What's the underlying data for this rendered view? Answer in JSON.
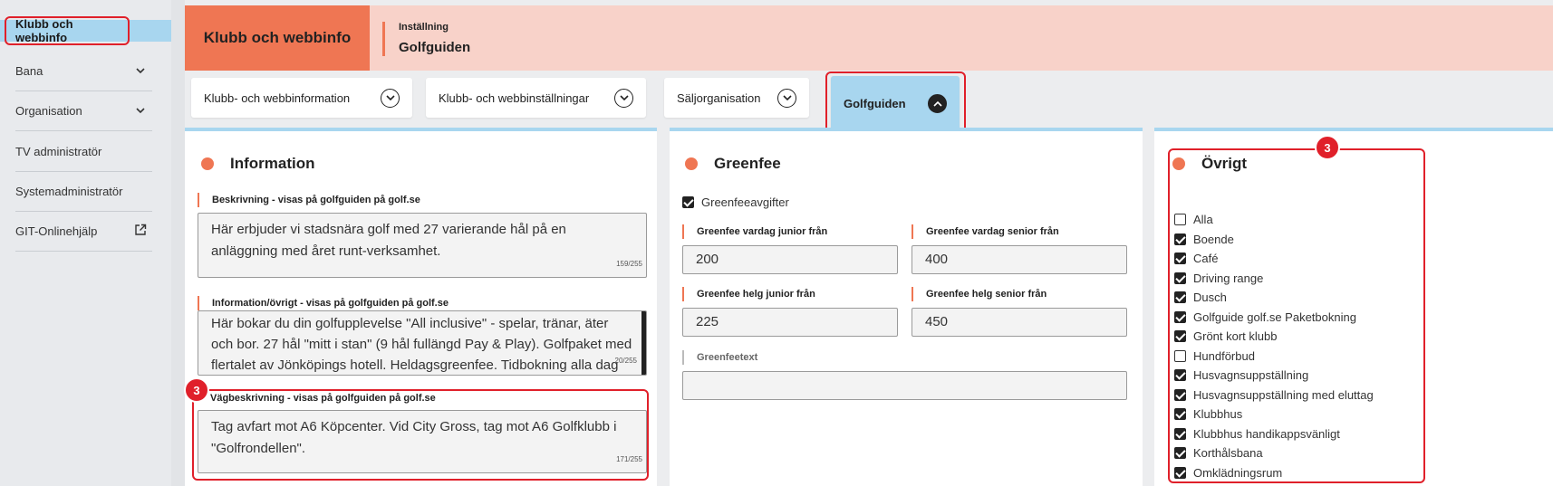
{
  "sidebar": {
    "active": "Klubb och webbinfo",
    "items": [
      {
        "label": "Bana",
        "has_chevron": true
      },
      {
        "label": "Organisation",
        "has_chevron": true
      },
      {
        "label": "TV administratör",
        "has_chevron": false
      },
      {
        "label": "Systemadministratör",
        "has_chevron": false
      },
      {
        "label": "GIT-Onlinehjälp",
        "has_external": true
      }
    ]
  },
  "header": {
    "title": "Klubb och webbinfo",
    "setting_label": "Inställning",
    "setting_value": "Golfguiden"
  },
  "tabs": [
    {
      "label": "Klubb- och webbinformation",
      "icon": "chevron-down-icon"
    },
    {
      "label": "Klubb- och webbinställningar",
      "icon": "chevron-down-icon"
    },
    {
      "label": "Säljorganisation",
      "icon": "chevron-down-icon"
    },
    {
      "label": "Golfguiden",
      "icon": "chevron-up-icon",
      "active": true
    }
  ],
  "information": {
    "title": "Information",
    "beskrivning_label": "Beskrivning - visas på golfguiden på golf.se",
    "beskrivning_text": "Här erbjuder vi stadsnära golf med 27 varierande hål på en anläggning med året runt-verksamhet.",
    "beskrivning_count": "159/255",
    "ovrigt_label": "Information/övrigt - visas på golfguiden på golf.se",
    "ovrigt_text": "Här bokar du din golfupplevelse \"All inclusive\" - spelar, tränar, äter och bor. 27 hål  \"mitt i stan\" (9 hål fullängd Pay & Play).  Golfpaket med flertalet av Jönköpings hotell. Heldagsgreenfee. Tidbokning alla dag",
    "ovrigt_count": "20/255",
    "vag_label": "Vägbeskrivning - visas på golfguiden på golf.se",
    "vag_text": "Tag avfart mot A6 Köpcenter. Vid City Gross, tag mot A6 Golfklubb i \"Golfrondellen\".",
    "vag_count": "171/255"
  },
  "greenfee": {
    "title": "Greenfee",
    "checkbox_label": "Greenfeeavgifter",
    "checkbox_checked": true,
    "vardag_junior_label": "Greenfee vardag junior från",
    "vardag_junior_value": "200",
    "vardag_senior_label": "Greenfee vardag senior från",
    "vardag_senior_value": "400",
    "helg_junior_label": "Greenfee helg junior från",
    "helg_junior_value": "225",
    "helg_senior_label": "Greenfee helg senior från",
    "helg_senior_value": "450",
    "text_label": "Greenfeetext",
    "text_value": ""
  },
  "ovrigt": {
    "title": "Övrigt",
    "options": [
      {
        "label": "Alla",
        "checked": false
      },
      {
        "label": "Boende",
        "checked": true
      },
      {
        "label": "Café",
        "checked": true
      },
      {
        "label": "Driving range",
        "checked": true
      },
      {
        "label": "Dusch",
        "checked": true
      },
      {
        "label": "Golfguide golf.se Paketbokning",
        "checked": true
      },
      {
        "label": "Grönt kort klubb",
        "checked": true
      },
      {
        "label": "Hundförbud",
        "checked": false
      },
      {
        "label": "Husvagnsuppställning",
        "checked": true
      },
      {
        "label": "Husvagnsuppställning med eluttag",
        "checked": true
      },
      {
        "label": "Klubbhus",
        "checked": true
      },
      {
        "label": "Klubbhus handikappsvänligt",
        "checked": true
      },
      {
        "label": "Korthålsbana",
        "checked": true
      },
      {
        "label": "Omklädningsrum",
        "checked": true
      }
    ]
  },
  "annotations": {
    "badge_info": "3",
    "badge_ovrigt": "3"
  },
  "colors": {
    "accent": "#ef7653",
    "active": "#a8d6ef",
    "highlight": "#e0202a"
  }
}
